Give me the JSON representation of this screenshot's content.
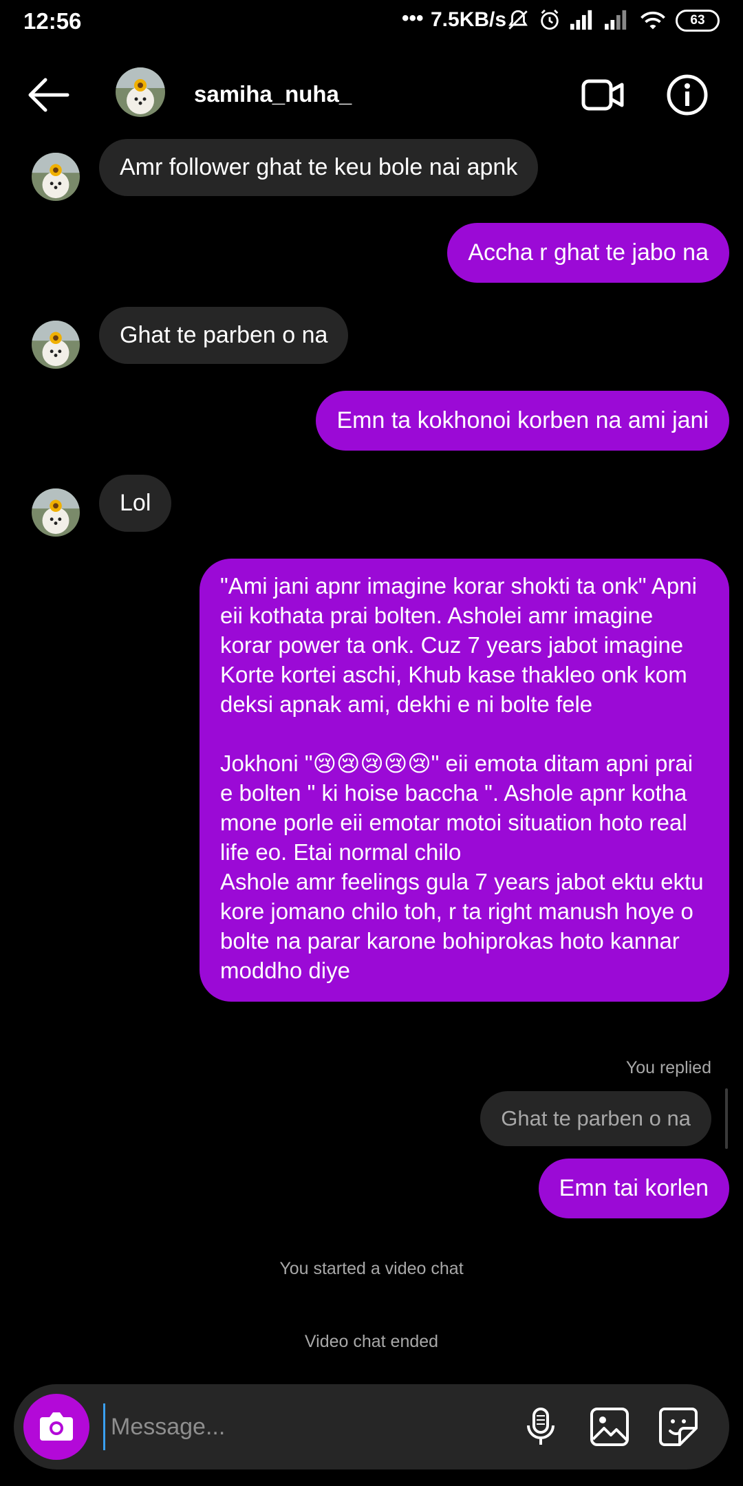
{
  "status_bar": {
    "time": "12:56",
    "net_speed": "7.5KB/s",
    "battery": "63"
  },
  "header": {
    "username": "samiha_nuha_"
  },
  "messages": [
    {
      "type": "in",
      "text": "Amr follower ghat te keu bole nai apnk"
    },
    {
      "type": "out",
      "text": "Accha r ghat te jabo na"
    },
    {
      "type": "in",
      "text": "Ghat te parben o na"
    },
    {
      "type": "out",
      "text": "Emn ta kokhonoi korben na ami jani"
    },
    {
      "type": "in",
      "text": "Lol"
    },
    {
      "type": "out",
      "text": "\"Ami jani apnr imagine korar shokti ta onk\" Apni eii kothata prai bolten. Asholei amr imagine korar power ta onk. Cuz 7 years jabot imagine Korte kortei aschi, Khub kase thakleo onk kom deksi apnak ami, dekhi e ni bolte fele\n\nJokhoni \"😢😢😢😢😢\" eii emota ditam apni prai e bolten \" ki hoise baccha \". Ashole apnr kotha mone porle eii emotar motoi situation hoto real life eo. Etai normal chilo\nAshole amr feelings gula 7 years jabot ektu ektu kore jomano chilo toh, r ta right manush hoye o bolte na parar karone bohiprokas hoto kannar moddho diye"
    },
    {
      "type": "out",
      "text": "Emn tai korlen"
    }
  ],
  "reply": {
    "label": "You replied",
    "quoted": "Ghat te parben o na"
  },
  "system": {
    "video_started": "You started a video chat",
    "video_ended": "Video chat ended"
  },
  "composer": {
    "placeholder": "Message..."
  }
}
